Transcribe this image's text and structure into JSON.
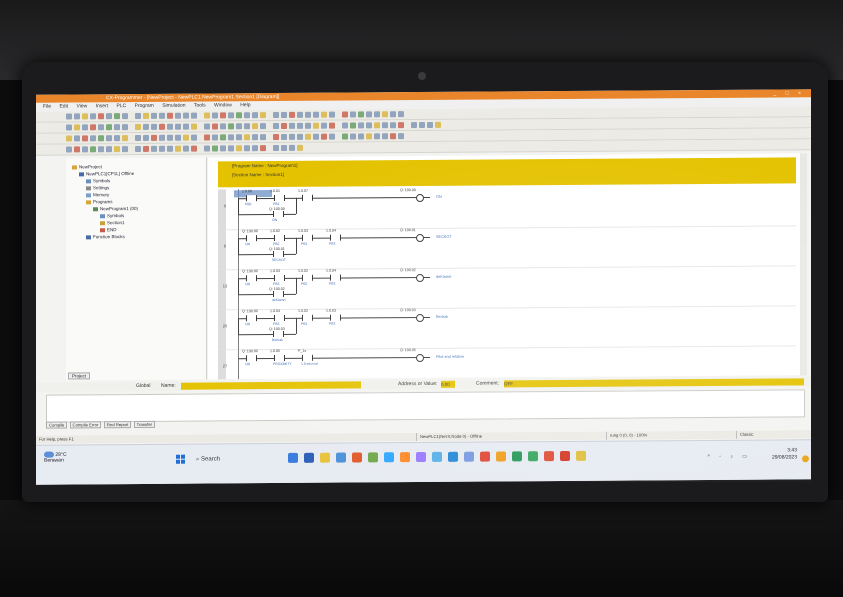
{
  "window": {
    "title": "CX-Programmer - [NewProject - NewPLC1.NewProgram1.Section1 [Diagram]]",
    "controls": "_ □ ×"
  },
  "menu": [
    "File",
    "Edit",
    "View",
    "Insert",
    "PLC",
    "Program",
    "Simulation",
    "Tools",
    "Window",
    "Help"
  ],
  "tree": {
    "items": [
      {
        "label": "NewProject",
        "indent": 0
      },
      {
        "label": "NewPLC1[CP1L] Offline",
        "indent": 1
      },
      {
        "label": "Symbols",
        "indent": 2
      },
      {
        "label": "Settings",
        "indent": 2
      },
      {
        "label": "Memory",
        "indent": 2
      },
      {
        "label": "Programs",
        "indent": 2
      },
      {
        "label": "NewProgram1 (00)",
        "indent": 3
      },
      {
        "label": "Symbols",
        "indent": 4
      },
      {
        "label": "Section1",
        "indent": 4
      },
      {
        "label": "END",
        "indent": 4
      },
      {
        "label": "Function Blocks",
        "indent": 2
      }
    ],
    "tab": "Project"
  },
  "header": {
    "program_name": "[Program Name : NewProgram1]",
    "section_name": "[Section Name : Section1]"
  },
  "rungs": [
    {
      "num": "0",
      "contacts": [
        {
          "addr": "1.0.00",
          "sym": "PB0"
        },
        {
          "addr": "1.0.01",
          "sym": "PB1"
        },
        {
          "addr": "1.0.07",
          "sym": ""
        }
      ],
      "branch": {
        "addr": "Q: 100.00",
        "sym": "ON"
      },
      "coil": {
        "addr": "Q: 100.00",
        "label": "ON"
      }
    },
    {
      "num": "6",
      "contacts": [
        {
          "addr": "Q: 100.00",
          "sym": "ON"
        },
        {
          "addr": "1.0.02",
          "sym": "PB2"
        },
        {
          "addr": "1.0.03",
          "sym": "PB1"
        },
        {
          "addr": "1.0.04",
          "sym": "PB3"
        }
      ],
      "branch": {
        "addr": "Q: 100.01",
        "sym": "SECKOT"
      },
      "coil": {
        "addr": "Q: 100.01",
        "label": "SECKOT"
      }
    },
    {
      "num": "13",
      "contacts": [
        {
          "addr": "Q: 100.00",
          "sym": "ON"
        },
        {
          "addr": "1.0.03",
          "sym": "PB3"
        },
        {
          "addr": "1.0.02",
          "sym": "PB2"
        },
        {
          "addr": "1.0.04",
          "sym": "PB3"
        }
      ],
      "branch": {
        "addr": "Q: 100.02",
        "sym": "deKlamrt"
      },
      "coil": {
        "addr": "Q: 100.02",
        "label": "deKlamrt"
      }
    },
    {
      "num": "20",
      "contacts": [
        {
          "addr": "Q: 100.00",
          "sym": "ON"
        },
        {
          "addr": "1.0.04",
          "sym": "PB3"
        },
        {
          "addr": "1.0.02",
          "sym": "PB1"
        },
        {
          "addr": "1.0.03",
          "sym": "PB2"
        }
      ],
      "branch": {
        "addr": "Q: 100.03",
        "sym": "Bertrak"
      },
      "coil": {
        "addr": "Q: 100.03",
        "label": "Bertrak"
      }
    },
    {
      "num": "27",
      "contacts": [
        {
          "addr": "Q: 100.00",
          "sym": "ON"
        },
        {
          "addr": "1.0.05",
          "sym": "PROXIMITY"
        },
        {
          "addr": "P_1s",
          "sym": "1.0 second"
        }
      ],
      "branch": null,
      "coil": {
        "addr": "Q: 100.05",
        "label": "Pilot end relative"
      }
    }
  ],
  "globalbar": {
    "global_label": "Global",
    "name_label": "Name:",
    "address_label": "Address or Value:",
    "address_value": "0.00",
    "comment_label": "Comment:",
    "comment_value": "OFF"
  },
  "output_tabs": [
    "Compile",
    "Compile Error",
    "Find Report",
    "Transfer"
  ],
  "status": {
    "help": "For Help, press F1",
    "plc": "NewPLC1(Net:0,Node:0) - Offline",
    "rung": "rung 0 (0, 0) - 100%",
    "mode": "Classic"
  },
  "taskbar": {
    "temp": "28°C",
    "weather": "Berawan",
    "search": "Search",
    "time": "3:43",
    "date": "29/08/2023"
  },
  "colors": {
    "accent_yellow": "#e4c200",
    "title_orange": "#e9852a",
    "symbol_blue": "#3a6cb7"
  }
}
